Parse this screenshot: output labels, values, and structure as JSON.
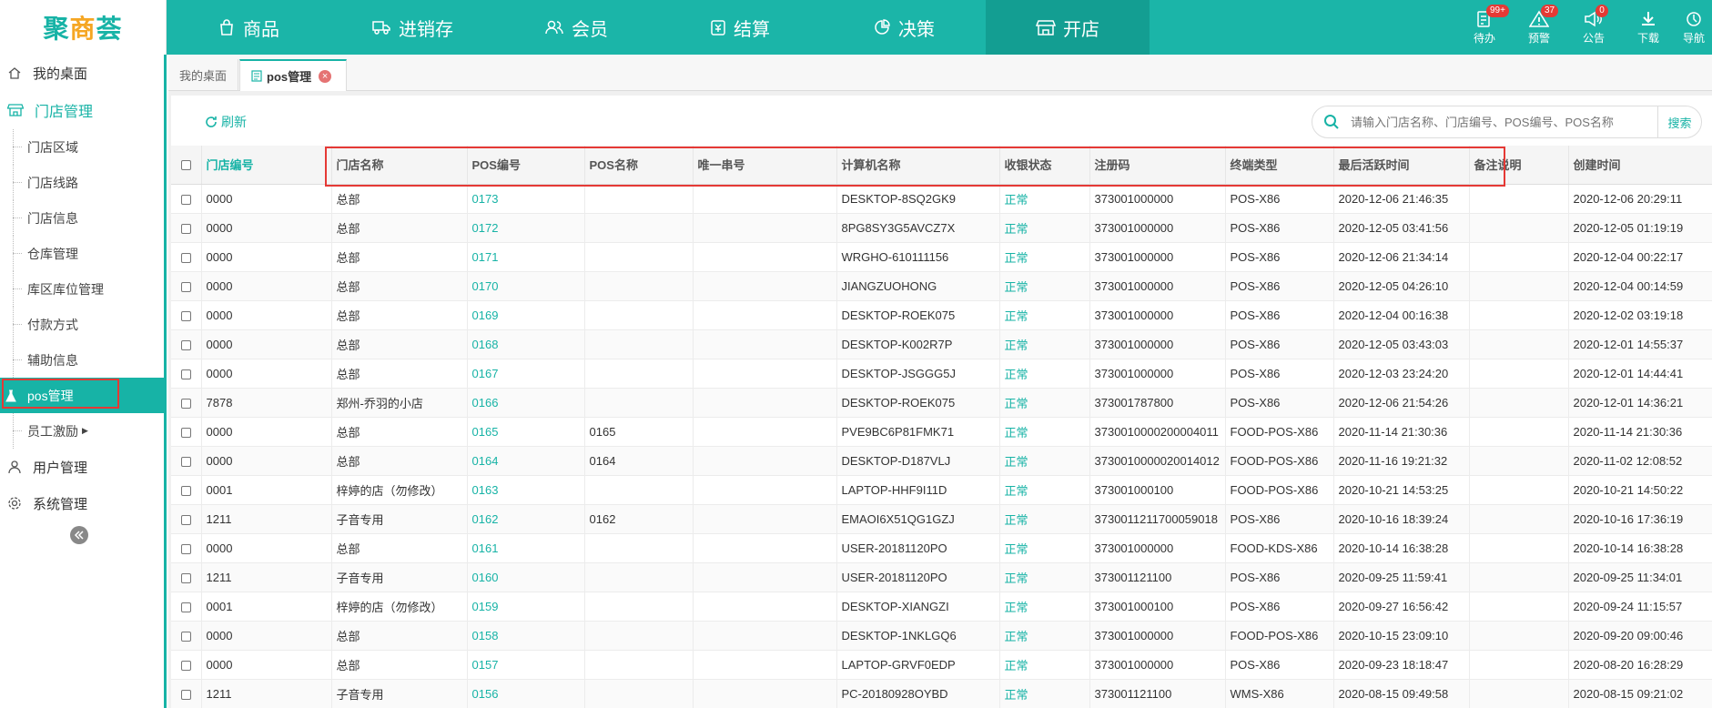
{
  "logo": {
    "part1": "聚",
    "accent": "商",
    "part2": "荟"
  },
  "nav": [
    {
      "label": "商品",
      "icon": "bag-icon"
    },
    {
      "label": "进销存",
      "icon": "truck-icon"
    },
    {
      "label": "会员",
      "icon": "users-icon"
    },
    {
      "label": "结算",
      "icon": "wallet-icon"
    },
    {
      "label": "决策",
      "icon": "chart-icon"
    },
    {
      "label": "开店",
      "icon": "store-icon"
    }
  ],
  "tools": [
    {
      "label": "待办",
      "badge": "99+",
      "icon": "todo-icon"
    },
    {
      "label": "预警",
      "badge": "37",
      "icon": "warning-icon"
    },
    {
      "label": "公告",
      "badge": "0",
      "icon": "speaker-icon"
    },
    {
      "label": "下载",
      "badge": "",
      "icon": "download-icon"
    },
    {
      "label": "导航",
      "badge": "",
      "icon": "nav-icon"
    }
  ],
  "sidebar": {
    "desktop": "我的桌面",
    "group": "门店管理",
    "items": [
      "门店区域",
      "门店线路",
      "门店信息",
      "仓库管理",
      "库区库位管理",
      "付款方式",
      "辅助信息",
      "pos管理",
      "员工激励"
    ],
    "user_mgmt": "用户管理",
    "system_mgmt": "系统管理"
  },
  "tabs": {
    "desktop": "我的桌面",
    "active": "pos管理",
    "close": "×"
  },
  "toolbar": {
    "refresh": "刷新",
    "search_placeholder": "请输入门店名称、门店编号、POS编号、POS名称",
    "search_btn": "搜索"
  },
  "table": {
    "headers": [
      "门店编号",
      "门店名称",
      "POS编号",
      "POS名称",
      "唯一串号",
      "计算机名称",
      "收银状态",
      "注册码",
      "终端类型",
      "最后活跃时间",
      "备注说明",
      "创建时间"
    ],
    "rows": [
      [
        "0000",
        "总部",
        "0173",
        "",
        "",
        "DESKTOP-8SQ2GK9",
        "正常",
        "373001000000",
        "POS-X86",
        "2020-12-06 21:46:35",
        "",
        "2020-12-06 20:29:11"
      ],
      [
        "0000",
        "总部",
        "0172",
        "",
        "",
        "8PG8SY3G5AVCZ7X",
        "正常",
        "373001000000",
        "POS-X86",
        "2020-12-05 03:41:56",
        "",
        "2020-12-05 01:19:19"
      ],
      [
        "0000",
        "总部",
        "0171",
        "",
        "",
        "WRGHO-610111156",
        "正常",
        "373001000000",
        "POS-X86",
        "2020-12-06 21:34:14",
        "",
        "2020-12-04 00:22:17"
      ],
      [
        "0000",
        "总部",
        "0170",
        "",
        "",
        "JIANGZUOHONG",
        "正常",
        "373001000000",
        "POS-X86",
        "2020-12-05 04:26:10",
        "",
        "2020-12-04 00:14:59"
      ],
      [
        "0000",
        "总部",
        "0169",
        "",
        "",
        "DESKTOP-ROEK075",
        "正常",
        "373001000000",
        "POS-X86",
        "2020-12-04 00:16:38",
        "",
        "2020-12-02 03:19:18"
      ],
      [
        "0000",
        "总部",
        "0168",
        "",
        "",
        "DESKTOP-K002R7P",
        "正常",
        "373001000000",
        "POS-X86",
        "2020-12-05 03:43:03",
        "",
        "2020-12-01 14:55:37"
      ],
      [
        "0000",
        "总部",
        "0167",
        "",
        "",
        "DESKTOP-JSGGG5J",
        "正常",
        "373001000000",
        "POS-X86",
        "2020-12-03 23:24:20",
        "",
        "2020-12-01 14:44:41"
      ],
      [
        "7878",
        "郑州-乔羽的小店",
        "0166",
        "",
        "",
        "DESKTOP-ROEK075",
        "正常",
        "373001787800",
        "POS-X86",
        "2020-12-06 21:54:26",
        "",
        "2020-12-01 14:36:21"
      ],
      [
        "0000",
        "总部",
        "0165",
        "0165",
        "",
        "PVE9BC6P81FMK71",
        "正常",
        "3730010000200004011",
        "FOOD-POS-X86",
        "2020-11-14 21:30:36",
        "",
        "2020-11-14 21:30:36"
      ],
      [
        "0000",
        "总部",
        "0164",
        "0164",
        "",
        "DESKTOP-D187VLJ",
        "正常",
        "3730010000020014012",
        "FOOD-POS-X86",
        "2020-11-16 19:21:32",
        "",
        "2020-11-02 12:08:52"
      ],
      [
        "0001",
        "梓婷的店（勿修改）",
        "0163",
        "",
        "",
        "LAPTOP-HHF9I11D",
        "正常",
        "373001000100",
        "FOOD-POS-X86",
        "2020-10-21 14:53:25",
        "",
        "2020-10-21 14:50:22"
      ],
      [
        "1211",
        "子音专用",
        "0162",
        "0162",
        "",
        "EMAOI6X51QG1GZJ",
        "正常",
        "3730011211700059018",
        "POS-X86",
        "2020-10-16 18:39:24",
        "",
        "2020-10-16 17:36:19"
      ],
      [
        "0000",
        "总部",
        "0161",
        "",
        "",
        "USER-20181120PO",
        "正常",
        "373001000000",
        "FOOD-KDS-X86",
        "2020-10-14 16:38:28",
        "",
        "2020-10-14 16:38:28"
      ],
      [
        "1211",
        "子音专用",
        "0160",
        "",
        "",
        "USER-20181120PO",
        "正常",
        "373001121100",
        "POS-X86",
        "2020-09-25 11:59:41",
        "",
        "2020-09-25 11:34:01"
      ],
      [
        "0001",
        "梓婷的店（勿修改）",
        "0159",
        "",
        "",
        "DESKTOP-XIANGZI",
        "正常",
        "373001000100",
        "POS-X86",
        "2020-09-27 16:56:42",
        "",
        "2020-09-24 11:15:57"
      ],
      [
        "0000",
        "总部",
        "0158",
        "",
        "",
        "DESKTOP-1NKLGQ6",
        "正常",
        "373001000000",
        "FOOD-POS-X86",
        "2020-10-15 23:09:10",
        "",
        "2020-09-20 09:00:46"
      ],
      [
        "0000",
        "总部",
        "0157",
        "",
        "",
        "LAPTOP-GRVF0EDP",
        "正常",
        "373001000000",
        "POS-X86",
        "2020-09-23 18:18:47",
        "",
        "2020-08-20 16:28:29"
      ],
      [
        "1211",
        "子音专用",
        "0156",
        "",
        "",
        "PC-20180928OYBD",
        "正常",
        "373001121100",
        "WMS-X86",
        "2020-08-15 09:49:58",
        "",
        "2020-08-15 09:21:02"
      ]
    ]
  },
  "colors": {
    "primary": "#1bb5a8",
    "primary_dark": "#139e92",
    "highlight": "#e53935"
  }
}
